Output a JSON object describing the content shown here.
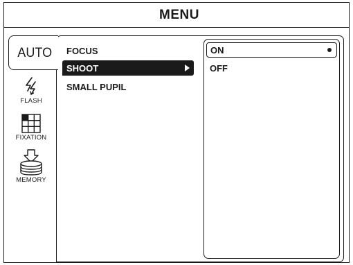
{
  "header": {
    "title": "MENU"
  },
  "tabs": [
    {
      "id": "auto",
      "label": "AUTO",
      "icon": null,
      "active": true
    },
    {
      "id": "flash",
      "label": "FLASH",
      "icon": "flash-icon",
      "active": false
    },
    {
      "id": "fixation",
      "label": "FIXATION",
      "icon": "grid-icon",
      "active": false
    },
    {
      "id": "memory",
      "label": "MEMORY",
      "icon": "memory-stack-icon",
      "active": false
    }
  ],
  "menu": {
    "items": [
      {
        "label": "FOCUS",
        "selected": false
      },
      {
        "label": "SHOOT",
        "selected": true,
        "has_submenu": true
      },
      {
        "label": "SMALL PUPIL",
        "selected": false
      }
    ]
  },
  "options": {
    "items": [
      {
        "label": "ON",
        "selected": true
      },
      {
        "label": "OFF",
        "selected": false
      }
    ]
  },
  "colors": {
    "foreground": "#1a1a1a",
    "background": "#ffffff",
    "highlight_text": "#ffffff"
  }
}
